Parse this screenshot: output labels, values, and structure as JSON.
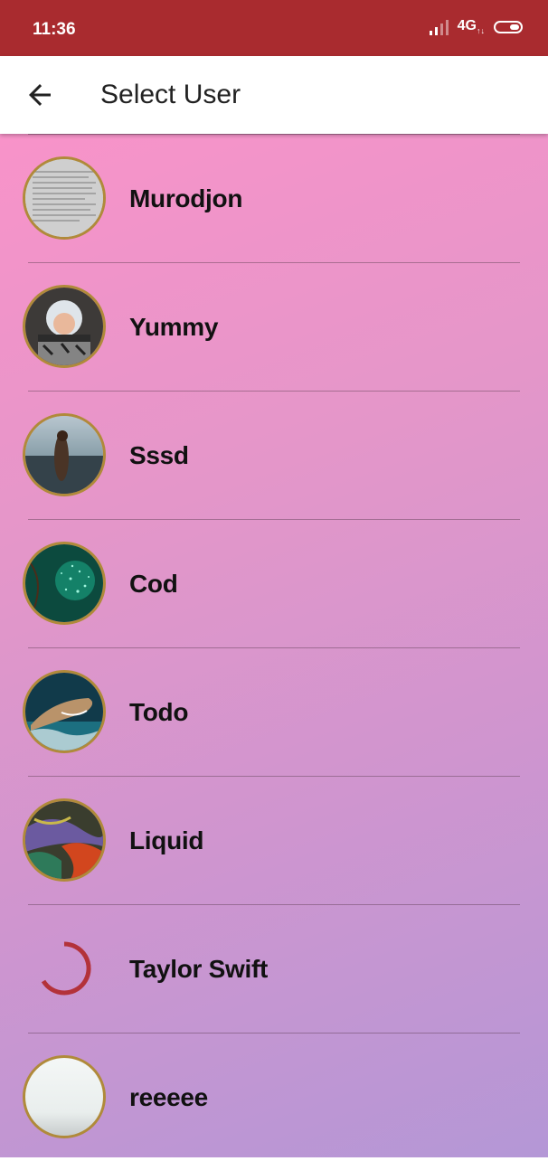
{
  "status_bar": {
    "time": "11:36",
    "network": "4G",
    "colors": {
      "background": "#a92b2f"
    }
  },
  "app_bar": {
    "title": "Select User",
    "back_icon": "arrow-left-icon"
  },
  "users": [
    {
      "name": "Murodjon",
      "avatar": "document-photo"
    },
    {
      "name": "Yummy",
      "avatar": "baby-photo"
    },
    {
      "name": "Sssd",
      "avatar": "beach-person-photo"
    },
    {
      "name": "Cod",
      "avatar": "green-sparkle-photo"
    },
    {
      "name": "Todo",
      "avatar": "shark-photo"
    },
    {
      "name": "Liquid",
      "avatar": "fluid-art-photo"
    },
    {
      "name": "Taylor Swift",
      "avatar": "loading-spinner"
    },
    {
      "name": "reeeee",
      "avatar": "blank-photo"
    }
  ],
  "colors": {
    "accent": "#a92b2f",
    "avatar_border": "#b08a3a",
    "gradient_top": "#f893c9",
    "gradient_bottom": "#b497d6"
  }
}
